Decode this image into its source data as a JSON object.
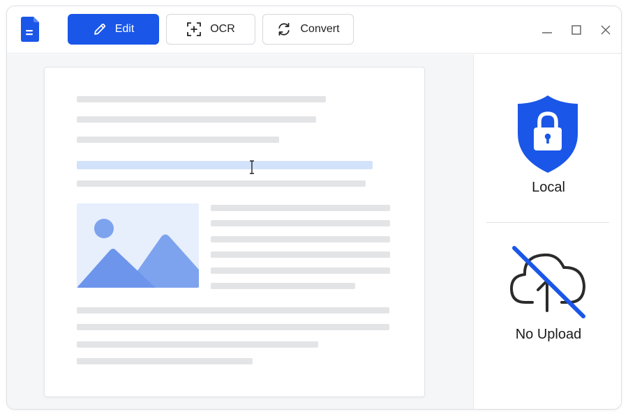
{
  "toolbar": {
    "edit_label": "Edit",
    "ocr_label": "OCR",
    "convert_label": "Convert"
  },
  "side_panel": {
    "local_label": "Local",
    "no_upload_label": "No Upload"
  },
  "icons": {
    "app": "document-icon",
    "edit": "pencil-icon",
    "ocr": "scan-plus-icon",
    "convert": "refresh-icon",
    "local": "shield-lock-icon",
    "no_upload": "cloud-upload-off-icon"
  },
  "colors": {
    "accent": "#1a56e8",
    "highlight": "#d3e2fb",
    "placeholder_line": "#e3e4e6",
    "image_bg": "#e7eefc",
    "image_shape": "#7ea3ee"
  }
}
